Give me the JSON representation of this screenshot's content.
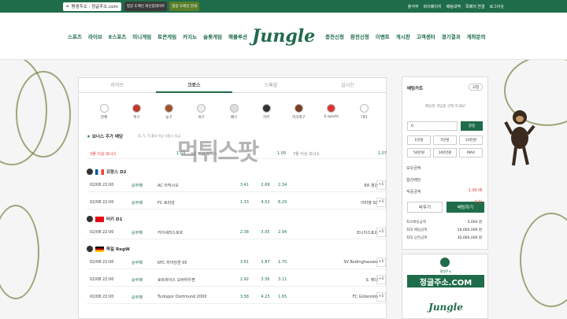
{
  "topbar": {
    "address_label": "평생주소 : 정글주소.com",
    "banner1": "정글 도메인 최신업데이트",
    "banner2": "정글 도메인 안내",
    "links": [
      "출석부",
      "파이페이지",
      "베팅내역",
      "쪽페지 연결",
      "로그아웃"
    ]
  },
  "nav": {
    "left": [
      "스포츠",
      "라이브",
      "E스포츠",
      "미니게임",
      "토큰게임",
      "카지노",
      "슬롯게임",
      "해볼루션"
    ],
    "logo": "Jungle",
    "right": [
      "충전신청",
      "환전신청",
      "이벤트",
      "게시판",
      "고객센터",
      "경기결과",
      "게좌문의"
    ]
  },
  "tabs": [
    "라이브",
    "크로스",
    "스페셜",
    "실시간"
  ],
  "sports": [
    "전체",
    "축구",
    "농구",
    "야구",
    "배구",
    "하키",
    "미식축구",
    "E-sports",
    "기타"
  ],
  "bonus": {
    "title": "보너스 추가 배당",
    "sub": "[3, 5, 7] 폴더 이상 조합시 지급",
    "row": {
      "label": "3폴 이상 보너스",
      "o1": "1.03",
      "label2": "3폴 이상 보너스",
      "o2": "1.05",
      "label3": "7폴 이상 보너스",
      "o3": "1.07"
    }
  },
  "watermark": "먹튀스팟",
  "leagues": [
    {
      "name": "프랑스 D2",
      "matches": [
        {
          "time": "02/08 22:00",
          "type": "승무패",
          "home": "AC 아작시오",
          "h": "3.41",
          "d": "2.69",
          "a": "2.34",
          "away": "EA 갱강"
        },
        {
          "time": "02/08 22:00",
          "type": "승무패",
          "home": "FC 로리앙",
          "h": "1.33",
          "d": "4.52",
          "a": "8.29",
          "away": "아미앵 SC"
        }
      ]
    },
    {
      "name": "터키 D1",
      "matches": [
        {
          "time": "02/08 22:00",
          "type": "승무패",
          "home": "카이세리스포르",
          "h": "2.38",
          "d": "3.05",
          "a": "2.94",
          "away": "코니아스포르"
        }
      ]
    },
    {
      "name": "독일 RegW",
      "matches": [
        {
          "time": "02/08 22:00",
          "type": "승무패",
          "home": "KFC 위어딩겐 05",
          "h": "3.61",
          "d": "3.87",
          "a": "1.70",
          "away": "SV Rodinghausen"
        },
        {
          "time": "02/08 22:00",
          "type": "승무패",
          "home": "로트바이스 오버하우젠",
          "h": "1.92",
          "d": "3.56",
          "a": "3.11",
          "away": "S. 뤼데"
        },
        {
          "time": "02/08 22:00",
          "type": "승무패",
          "home": "Turkspor Dortmund 2000",
          "h": "3.58",
          "d": "4.23",
          "a": "1.65",
          "away": "FC Gütersloh"
        }
      ]
    }
  ],
  "cart": {
    "title": "배팅카트",
    "reset": "고정",
    "empty": "배팅할 게임을 선택 하세요!",
    "amount": "0",
    "max_btn": "정정",
    "chips": [
      "1만원",
      "5만원",
      "10만원",
      "50만원",
      "100만원",
      "MAX"
    ],
    "labels": [
      "보유금액",
      "합산배당",
      "적중금액"
    ],
    "values": [
      "",
      "1.00 배",
      "0 원"
    ],
    "clear": "비우기",
    "bet": "배팅하기",
    "limits": [
      [
        "최소배팅금액",
        "5,000 원"
      ],
      [
        "최대 배팅금액",
        "10,000,000 원"
      ],
      [
        "최대 상한금액",
        "30,000,000 원"
      ]
    ]
  },
  "ad": {
    "domain": "정글주소.COM",
    "sub": "Jungle",
    "small": "평생주소"
  },
  "colors": {
    "brand": "#1f6c4a",
    "accent": "#e53935"
  }
}
